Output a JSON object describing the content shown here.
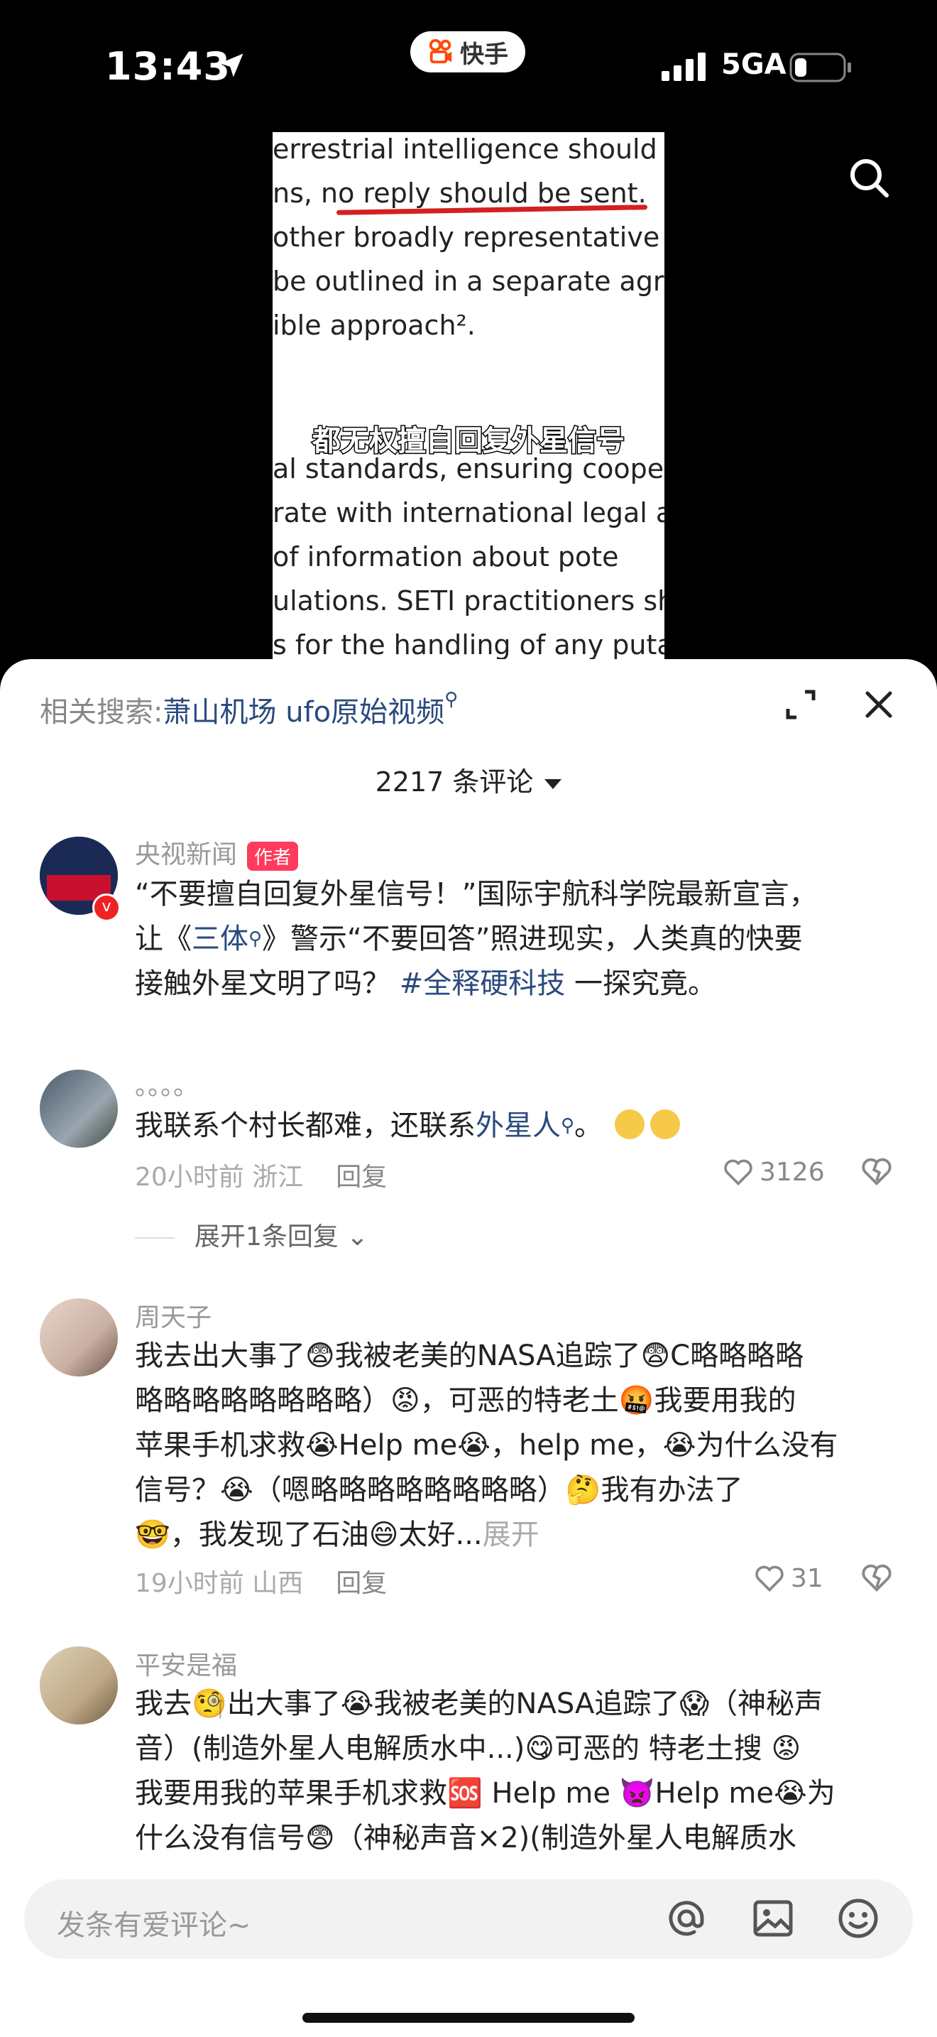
{
  "status": {
    "time": "13:43",
    "network": "5GA",
    "app_name": "快手"
  },
  "video": {
    "doc_lines": [
      "errestrial intelligence should b",
      "ns,  no  reply  should  be  sent.",
      " other broadly representative",
      " be outlined in a separate agr",
      "ible approach².",
      "al  standards,  ensuring  coope",
      "rate with international legal au",
      " of  information  about  pote",
      "ulations.  SETI  practitioners  sh",
      "s for the handling of any putat"
    ],
    "subtitle": "都无权擅自回复外星信号"
  },
  "sheet": {
    "related_label": "相关搜索:",
    "related_query": "萧山机场 ufo原始视频",
    "comment_count": "2217 条评论"
  },
  "comments": [
    {
      "name": "央视新闻",
      "badge": "作者",
      "avatar_text": "央视新闻",
      "text_1": "“不要擅自回复外星信号！”国际宇航科学院最新宣言，",
      "text_2a": "让《",
      "link_1": "三体",
      "text_2b": "》警示“不要回答”照进现实，人类真的快要",
      "text_3a": "接触外星文明了吗？",
      "link_2": "#全释硬科技",
      "text_3b": "一探究竟。"
    },
    {
      "name": "。。。。",
      "text_a": "我联系个村长都难，还联系",
      "link": "外星人",
      "text_b": "。",
      "time_loc": "20小时前 浙江",
      "reply": "回复",
      "likes": "3126",
      "expand": "展开1条回复"
    },
    {
      "name": "周天子",
      "line_1": "我去出大事了😨我被老美的NASA追踪了😨C略略略略",
      "line_2": "略略略略略略略略）😡，可恶的特老土🤬我要用我的",
      "line_3": "苹果手机求救😭Help me😭，help me，😭为什么没有",
      "line_4": "信号？😭（嗯略略略略略略略略）🤔我有办法了",
      "line_5": "🤓，我发现了石油😄太好...",
      "more": "展开",
      "time_loc": "19小时前 山西",
      "reply": "回复",
      "likes": "31"
    },
    {
      "name": "平安是福",
      "line_1": "我去🧐出大事了😭我被老美的NASA追踪了😱（神秘声",
      "line_2": "音）(制造外星人电解质水中...)😋可恶的 特老土搜 😡",
      "line_3": "我要用我的苹果手机求救🆘 Help me 👿Help me😭为",
      "line_4": "什么没有信号😨（神秘声音×2)(制造外星人电解质水"
    }
  ],
  "input": {
    "placeholder": "发条有爱评论~"
  },
  "icons": [
    "location-arrow-icon",
    "kuaishou-logo-icon",
    "signal-icon",
    "battery-icon",
    "search-icon",
    "expand-icon",
    "close-icon",
    "caret-down-icon",
    "heart-icon",
    "dislike-heart-icon",
    "at-icon",
    "image-icon",
    "emoji-icon",
    "chevron-down-icon"
  ]
}
